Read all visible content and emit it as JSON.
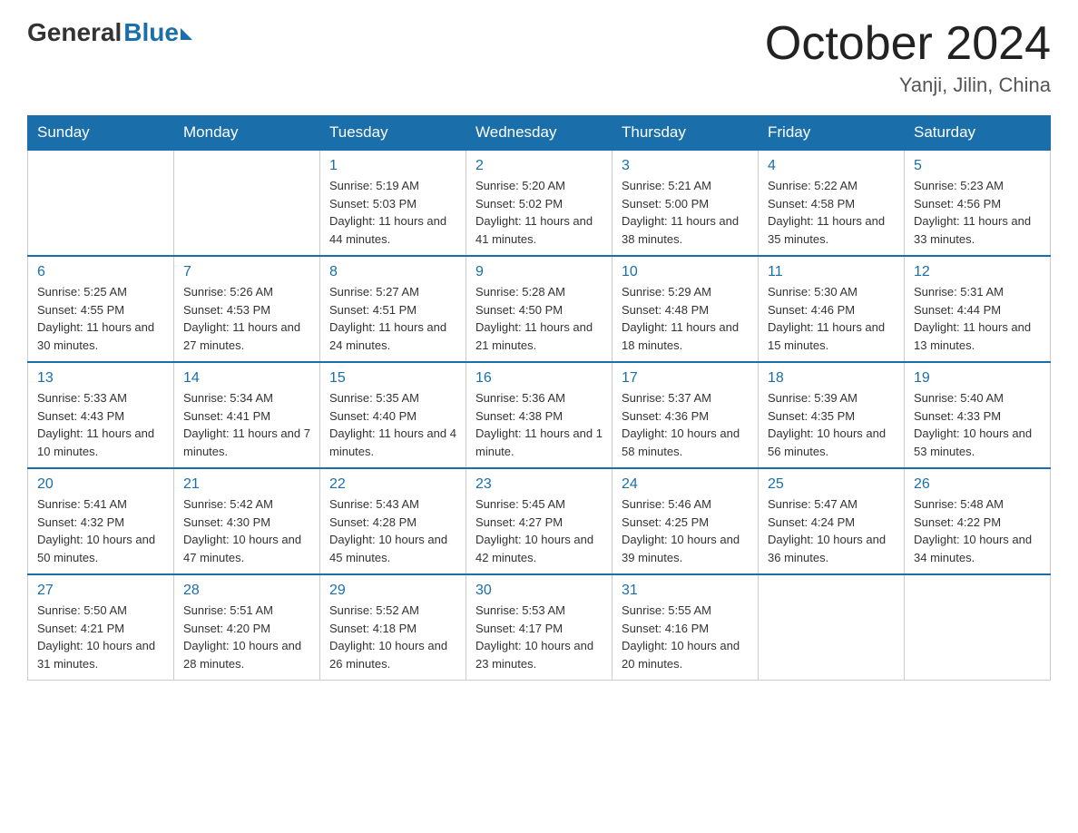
{
  "header": {
    "logo_general": "General",
    "logo_blue": "Blue",
    "title": "October 2024",
    "subtitle": "Yanji, Jilin, China"
  },
  "weekdays": [
    "Sunday",
    "Monday",
    "Tuesday",
    "Wednesday",
    "Thursday",
    "Friday",
    "Saturday"
  ],
  "weeks": [
    [
      {
        "day": "",
        "sunrise": "",
        "sunset": "",
        "daylight": ""
      },
      {
        "day": "",
        "sunrise": "",
        "sunset": "",
        "daylight": ""
      },
      {
        "day": "1",
        "sunrise": "Sunrise: 5:19 AM",
        "sunset": "Sunset: 5:03 PM",
        "daylight": "Daylight: 11 hours and 44 minutes."
      },
      {
        "day": "2",
        "sunrise": "Sunrise: 5:20 AM",
        "sunset": "Sunset: 5:02 PM",
        "daylight": "Daylight: 11 hours and 41 minutes."
      },
      {
        "day": "3",
        "sunrise": "Sunrise: 5:21 AM",
        "sunset": "Sunset: 5:00 PM",
        "daylight": "Daylight: 11 hours and 38 minutes."
      },
      {
        "day": "4",
        "sunrise": "Sunrise: 5:22 AM",
        "sunset": "Sunset: 4:58 PM",
        "daylight": "Daylight: 11 hours and 35 minutes."
      },
      {
        "day": "5",
        "sunrise": "Sunrise: 5:23 AM",
        "sunset": "Sunset: 4:56 PM",
        "daylight": "Daylight: 11 hours and 33 minutes."
      }
    ],
    [
      {
        "day": "6",
        "sunrise": "Sunrise: 5:25 AM",
        "sunset": "Sunset: 4:55 PM",
        "daylight": "Daylight: 11 hours and 30 minutes."
      },
      {
        "day": "7",
        "sunrise": "Sunrise: 5:26 AM",
        "sunset": "Sunset: 4:53 PM",
        "daylight": "Daylight: 11 hours and 27 minutes."
      },
      {
        "day": "8",
        "sunrise": "Sunrise: 5:27 AM",
        "sunset": "Sunset: 4:51 PM",
        "daylight": "Daylight: 11 hours and 24 minutes."
      },
      {
        "day": "9",
        "sunrise": "Sunrise: 5:28 AM",
        "sunset": "Sunset: 4:50 PM",
        "daylight": "Daylight: 11 hours and 21 minutes."
      },
      {
        "day": "10",
        "sunrise": "Sunrise: 5:29 AM",
        "sunset": "Sunset: 4:48 PM",
        "daylight": "Daylight: 11 hours and 18 minutes."
      },
      {
        "day": "11",
        "sunrise": "Sunrise: 5:30 AM",
        "sunset": "Sunset: 4:46 PM",
        "daylight": "Daylight: 11 hours and 15 minutes."
      },
      {
        "day": "12",
        "sunrise": "Sunrise: 5:31 AM",
        "sunset": "Sunset: 4:44 PM",
        "daylight": "Daylight: 11 hours and 13 minutes."
      }
    ],
    [
      {
        "day": "13",
        "sunrise": "Sunrise: 5:33 AM",
        "sunset": "Sunset: 4:43 PM",
        "daylight": "Daylight: 11 hours and 10 minutes."
      },
      {
        "day": "14",
        "sunrise": "Sunrise: 5:34 AM",
        "sunset": "Sunset: 4:41 PM",
        "daylight": "Daylight: 11 hours and 7 minutes."
      },
      {
        "day": "15",
        "sunrise": "Sunrise: 5:35 AM",
        "sunset": "Sunset: 4:40 PM",
        "daylight": "Daylight: 11 hours and 4 minutes."
      },
      {
        "day": "16",
        "sunrise": "Sunrise: 5:36 AM",
        "sunset": "Sunset: 4:38 PM",
        "daylight": "Daylight: 11 hours and 1 minute."
      },
      {
        "day": "17",
        "sunrise": "Sunrise: 5:37 AM",
        "sunset": "Sunset: 4:36 PM",
        "daylight": "Daylight: 10 hours and 58 minutes."
      },
      {
        "day": "18",
        "sunrise": "Sunrise: 5:39 AM",
        "sunset": "Sunset: 4:35 PM",
        "daylight": "Daylight: 10 hours and 56 minutes."
      },
      {
        "day": "19",
        "sunrise": "Sunrise: 5:40 AM",
        "sunset": "Sunset: 4:33 PM",
        "daylight": "Daylight: 10 hours and 53 minutes."
      }
    ],
    [
      {
        "day": "20",
        "sunrise": "Sunrise: 5:41 AM",
        "sunset": "Sunset: 4:32 PM",
        "daylight": "Daylight: 10 hours and 50 minutes."
      },
      {
        "day": "21",
        "sunrise": "Sunrise: 5:42 AM",
        "sunset": "Sunset: 4:30 PM",
        "daylight": "Daylight: 10 hours and 47 minutes."
      },
      {
        "day": "22",
        "sunrise": "Sunrise: 5:43 AM",
        "sunset": "Sunset: 4:28 PM",
        "daylight": "Daylight: 10 hours and 45 minutes."
      },
      {
        "day": "23",
        "sunrise": "Sunrise: 5:45 AM",
        "sunset": "Sunset: 4:27 PM",
        "daylight": "Daylight: 10 hours and 42 minutes."
      },
      {
        "day": "24",
        "sunrise": "Sunrise: 5:46 AM",
        "sunset": "Sunset: 4:25 PM",
        "daylight": "Daylight: 10 hours and 39 minutes."
      },
      {
        "day": "25",
        "sunrise": "Sunrise: 5:47 AM",
        "sunset": "Sunset: 4:24 PM",
        "daylight": "Daylight: 10 hours and 36 minutes."
      },
      {
        "day": "26",
        "sunrise": "Sunrise: 5:48 AM",
        "sunset": "Sunset: 4:22 PM",
        "daylight": "Daylight: 10 hours and 34 minutes."
      }
    ],
    [
      {
        "day": "27",
        "sunrise": "Sunrise: 5:50 AM",
        "sunset": "Sunset: 4:21 PM",
        "daylight": "Daylight: 10 hours and 31 minutes."
      },
      {
        "day": "28",
        "sunrise": "Sunrise: 5:51 AM",
        "sunset": "Sunset: 4:20 PM",
        "daylight": "Daylight: 10 hours and 28 minutes."
      },
      {
        "day": "29",
        "sunrise": "Sunrise: 5:52 AM",
        "sunset": "Sunset: 4:18 PM",
        "daylight": "Daylight: 10 hours and 26 minutes."
      },
      {
        "day": "30",
        "sunrise": "Sunrise: 5:53 AM",
        "sunset": "Sunset: 4:17 PM",
        "daylight": "Daylight: 10 hours and 23 minutes."
      },
      {
        "day": "31",
        "sunrise": "Sunrise: 5:55 AM",
        "sunset": "Sunset: 4:16 PM",
        "daylight": "Daylight: 10 hours and 20 minutes."
      },
      {
        "day": "",
        "sunrise": "",
        "sunset": "",
        "daylight": ""
      },
      {
        "day": "",
        "sunrise": "",
        "sunset": "",
        "daylight": ""
      }
    ]
  ]
}
